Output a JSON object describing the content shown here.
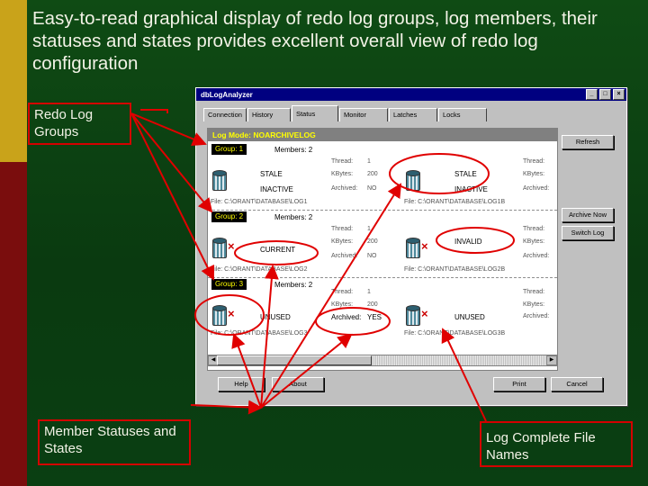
{
  "slide": {
    "headline": "Easy-to-read graphical display of redo log groups, log members, their statuses and states provides excellent overall view of redo log configuration",
    "callouts": {
      "groups": "Redo Log Groups",
      "statuses": "Member Statuses and States",
      "filenames": "Log Complete File Names"
    }
  },
  "window": {
    "title": "dbLogAnalyzer",
    "tabs": [
      "Connection",
      "History",
      "Status",
      "Monitor",
      "Latches",
      "Locks"
    ],
    "active_tab": "Status",
    "log_mode": "Log Mode: NOARCHIVELOG",
    "groups": [
      {
        "label": "Group: 1",
        "members": "Members: 2",
        "left_member": {
          "status": "STALE",
          "state": "INACTIVE",
          "file": "File: C:\\ORANT\\DATABASE\\LOG1"
        },
        "mid": {
          "thread": "Thread:",
          "thread_val": "1",
          "kbytes": "KBytes:",
          "kbytes_val": "200",
          "archived": "Archived:",
          "archived_val": "NO"
        },
        "right_member": {
          "status": "STALE",
          "state": "INACTIVE",
          "file": "File: C:\\ORANT\\DATABASE\\LOG1B"
        },
        "right_info": {
          "thread": "Thread:",
          "kbytes": "KBytes:",
          "archived": "Archived:"
        }
      },
      {
        "label": "Group: 2",
        "members": "Members: 2",
        "left_member": {
          "status": "CURRENT",
          "state": "",
          "file": "File: C:\\ORANT\\DATABASE\\LOG2"
        },
        "mid": {
          "thread": "Thread:",
          "thread_val": "1",
          "kbytes": "KBytes:",
          "kbytes_val": "200",
          "archived": "Archived:",
          "archived_val": "NO"
        },
        "right_member": {
          "status": "INVALID",
          "state": "",
          "file": "File: C:\\ORANT\\DATABASE\\LOG2B"
        },
        "right_info": {
          "thread": "Thread:",
          "kbytes": "KBytes:",
          "archived": "Archived:"
        }
      },
      {
        "label": "Group: 3",
        "members": "Members: 2",
        "left_member": {
          "status": "UNUSED",
          "state": "",
          "file": "File: C:\\ORANT\\DATABASE\\LOG3"
        },
        "mid": {
          "thread": "Thread:",
          "thread_val": "1",
          "kbytes": "KBytes:",
          "kbytes_val": "200",
          "archived": "Archived:",
          "archived_val": "YES"
        },
        "right_member": {
          "status": "UNUSED",
          "state": "",
          "file": "File: C:\\ORANT\\DATABASE\\LOG3B"
        },
        "right_info": {
          "thread": "Thread:",
          "kbytes": "KBytes:",
          "archived": "Archived:"
        }
      }
    ],
    "side_buttons": {
      "refresh": "Refresh",
      "archive_now": "Archive Now",
      "switch_log": "Switch Log"
    },
    "bottom_buttons": {
      "help": "Help",
      "about": "About",
      "print": "Print",
      "cancel": "Cancel"
    }
  },
  "colors": {
    "background": "#0f4b14",
    "callout_border": "#d40000",
    "title_bar": "#000080",
    "log_mode_text": "#ffff00",
    "stripe_top": "#c9a31a",
    "stripe_bottom": "#7a0d0d"
  }
}
